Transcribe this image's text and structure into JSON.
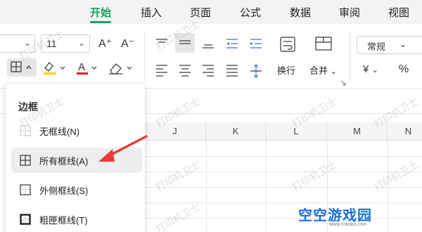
{
  "tabs": [
    "开始",
    "插入",
    "页面",
    "公式",
    "数据",
    "审阅",
    "视图"
  ],
  "ribbon": {
    "font_size": "11",
    "increase_font": "A⁺",
    "decrease_font": "A⁻",
    "wrap_label": "换行",
    "merge_label": "合并",
    "number_format": "常规",
    "currency_symbol": "¥",
    "percent_symbol": "%"
  },
  "columns": [
    "J",
    "K",
    "L",
    "M",
    "N"
  ],
  "menu": {
    "title": "边框",
    "items": [
      {
        "label": "无框线(N)"
      },
      {
        "label": "所有框线(A)"
      },
      {
        "label": "外侧框线(S)"
      },
      {
        "label": "粗匣框线(T)"
      }
    ]
  },
  "watermark_text": "打印机卫士",
  "logo_text": "空空游戏园",
  "logo_sub": "www.cckoko.com",
  "colors": {
    "accent": "#1a9e5a",
    "font_color": "#e02020",
    "highlight": "#f5d800",
    "arrow": "#e83a3a"
  }
}
